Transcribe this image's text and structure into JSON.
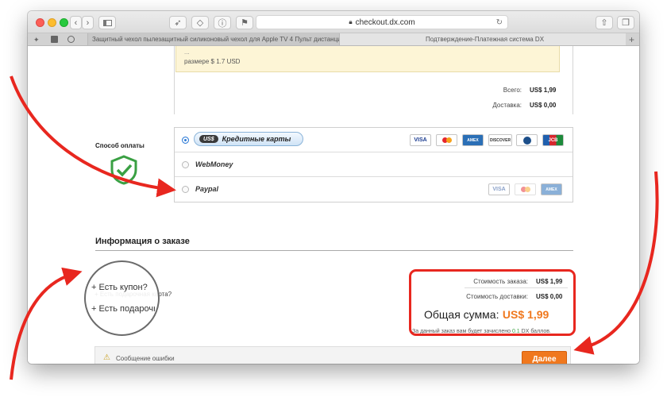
{
  "browser": {
    "address": "checkout.dx.com",
    "tabs": [
      {
        "label": "Защитный чехол пылезащитный силиконовый чехол для Apple TV 4 Пульт дистанционного у..."
      },
      {
        "label": "Подтверждение-Платежная система DX"
      }
    ]
  },
  "shipping_note": {
    "line1": "...",
    "line2": "размере $ 1.7 USD"
  },
  "totals": {
    "total_label": "Всего:",
    "total_value": "US$ 1,99",
    "shipping_label": "Доставка:",
    "shipping_value": "US$ 0,00"
  },
  "payment": {
    "title": "Способ оплаты",
    "options": [
      {
        "label": "Кредитные карты",
        "badge": "US$",
        "selected": true
      },
      {
        "label": "WebMoney",
        "selected": false
      },
      {
        "label": "Paypal",
        "selected": false
      }
    ],
    "cards": [
      "VISA",
      "MC",
      "AMEX",
      "DISCOVER",
      "DC",
      "JCB"
    ],
    "paypal_cards": [
      "VISA",
      "MC",
      "AMEX"
    ]
  },
  "order_info": {
    "title": "Информация о заказе",
    "coupon_link": "+ Есть купон?",
    "gift_link": "+ Есть подарочная карта?"
  },
  "summary": {
    "order_cost_label": "Стоимость заказа:",
    "order_cost_value": "US$ 1,99",
    "delivery_cost_label": "Стоимость доставки:",
    "delivery_cost_value": "US$ 0,00",
    "grand_total_label": "Общая сумма:",
    "grand_total_value": "US$ 1,99",
    "points_text_before": "За данный заказ вам будет зачислено",
    "points_value": "0.1",
    "points_text_after": "DX баллов."
  },
  "footer": {
    "error_label": "Сообщение ошибки",
    "next_button": "Далее"
  },
  "colors": {
    "accent": "#f0781e",
    "annotation": "#e8271f",
    "shield": "#3aa043",
    "selected_radio": "#2e7bd6"
  }
}
